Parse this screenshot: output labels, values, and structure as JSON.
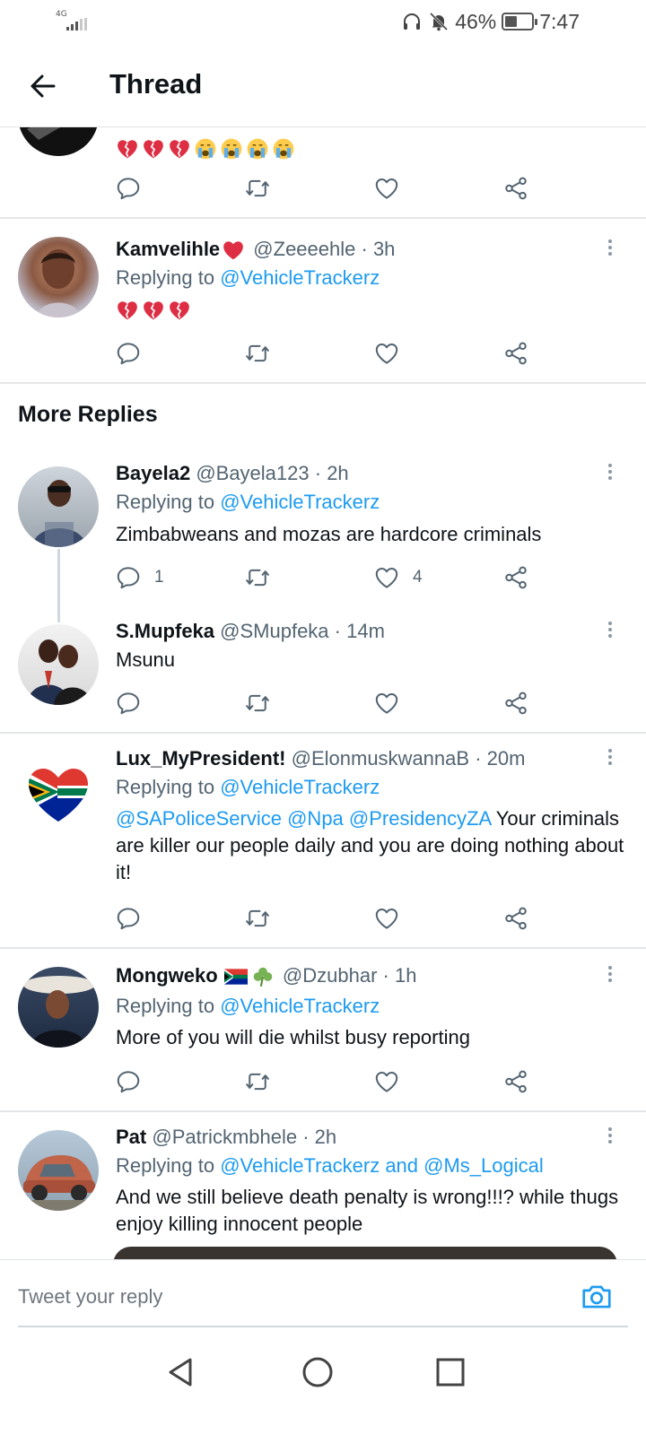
{
  "status_bar": {
    "network": "4G",
    "battery_percent": "46%",
    "battery_level": 0.46,
    "time": "7:47"
  },
  "header": {
    "title": "Thread"
  },
  "tweets_top": [
    {
      "id": "prev",
      "body_emojis": [
        "broken-heart",
        "broken-heart",
        "broken-heart",
        "crying-face",
        "crying-face",
        "crying-face",
        "crying-face"
      ]
    },
    {
      "id": "kam",
      "name": "Kamvelihle",
      "name_emoji": "red-heart",
      "handle": "@Zeeeehle",
      "time": "· 3h",
      "replying_prefix": "Replying to ",
      "replying_to": "@VehicleTrackerz",
      "body_emojis": [
        "broken-heart",
        "broken-heart",
        "broken-heart"
      ]
    }
  ],
  "section": {
    "title": "More Replies"
  },
  "replies": [
    {
      "name": "Bayela2",
      "handle": "@Bayela123",
      "time": "· 2h",
      "replying_prefix": "Replying to ",
      "replying_to": "@VehicleTrackerz",
      "body": "Zimbabweans and mozas are hardcore criminals",
      "reply_count": "1",
      "like_count": "4"
    },
    {
      "name": "S.Mupfeka",
      "handle": "@SMupfeka",
      "time": "· 14m",
      "body": "Msunu"
    },
    {
      "name": "Lux_MyPresident!",
      "handle": "@ElonmuskwannaB",
      "time": "· 20m",
      "replying_prefix": "Replying to ",
      "replying_to": "@VehicleTrackerz",
      "mentions": [
        "@SAPoliceService",
        "@Npa",
        "@PresidencyZA"
      ],
      "body": "Your criminals are killer our people daily and you are doing nothing about it!"
    },
    {
      "name": "Mongweko",
      "name_emojis": [
        "south-africa-flag",
        "shamrock"
      ],
      "handle": "@Dzubhar",
      "time": "· 1h",
      "replying_prefix": "Replying to ",
      "replying_to": "@VehicleTrackerz",
      "body": "More of you will die whilst busy reporting"
    },
    {
      "name": "Pat",
      "handle": "@Patrickmbhele",
      "time": "· 2h",
      "replying_prefix": "Replying to ",
      "replying_to": "@VehicleTrackerz and @Ms_Logical",
      "body": "And we still believe death penalty is wrong!!!? while thugs enjoy killing innocent people"
    }
  ],
  "reply_bar": {
    "placeholder": "Tweet your reply"
  },
  "icons": {
    "reply": "reply-icon",
    "retweet": "retweet-icon",
    "like": "like-icon",
    "share": "share-icon",
    "camera": "camera-icon",
    "back": "back-arrow-icon"
  },
  "colors": {
    "link": "#1d9bf0",
    "muted": "#536471",
    "text": "#0f1419",
    "separator": "#e3e6e8"
  }
}
